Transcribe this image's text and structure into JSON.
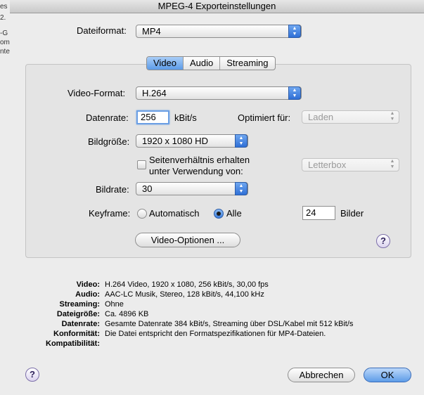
{
  "background_window": {
    "fragments": [
      "es",
      "2.",
      "-G",
      "om",
      "nte"
    ]
  },
  "window": {
    "title": "MPEG-4 Exporteinstellungen"
  },
  "file_format": {
    "label": "Dateiformat:",
    "value": "MP4"
  },
  "tabs": [
    {
      "label": "Video",
      "active": true
    },
    {
      "label": "Audio",
      "active": false
    },
    {
      "label": "Streaming",
      "active": false
    }
  ],
  "video": {
    "format_label": "Video-Format:",
    "format_value": "H.264",
    "datarate_label": "Datenrate:",
    "datarate_value": "256",
    "datarate_unit": "kBit/s",
    "optimized_label": "Optimiert für:",
    "optimized_value": "Laden",
    "size_label": "Bildgröße:",
    "size_value": "1920 x 1080 HD",
    "aspect_line1": "Seitenverhältnis erhalten",
    "aspect_line2": "unter Verwendung von:",
    "aspect_value": "Letterbox",
    "framerate_label": "Bildrate:",
    "framerate_value": "30",
    "keyframe_label": "Keyframe:",
    "keyframe_auto": "Automatisch",
    "keyframe_all": "Alle",
    "keyframe_value": "24",
    "keyframe_unit": "Bilder",
    "options_button": "Video-Optionen ..."
  },
  "summary": [
    {
      "key": "Video:",
      "value": "H.264 Video, 1920 x 1080, 256 kBit/s, 30,00 fps"
    },
    {
      "key": "Audio:",
      "value": "AAC-LC Musik, Stereo, 128 kBit/s, 44,100 kHz"
    },
    {
      "key": "Streaming:",
      "value": "Ohne"
    },
    {
      "key": "Dateigröße:",
      "value": "Ca. 4896 KB"
    },
    {
      "key": "Datenrate:",
      "value": "Gesamte Datenrate 384 kBit/s, Streaming über DSL/Kabel mit 512 kBit/s"
    },
    {
      "key": "Konformität:",
      "value": "Die Datei entspricht den Formatspezifikationen für MP4-Dateien."
    },
    {
      "key": "Kompatibilität:",
      "value": ""
    }
  ],
  "buttons": {
    "cancel": "Abbrechen",
    "ok": "OK",
    "help": "?"
  },
  "colors": {
    "accent": "#5e9ce8",
    "sheet_bg": "#ececec",
    "group_bg": "#e4e4e4"
  }
}
